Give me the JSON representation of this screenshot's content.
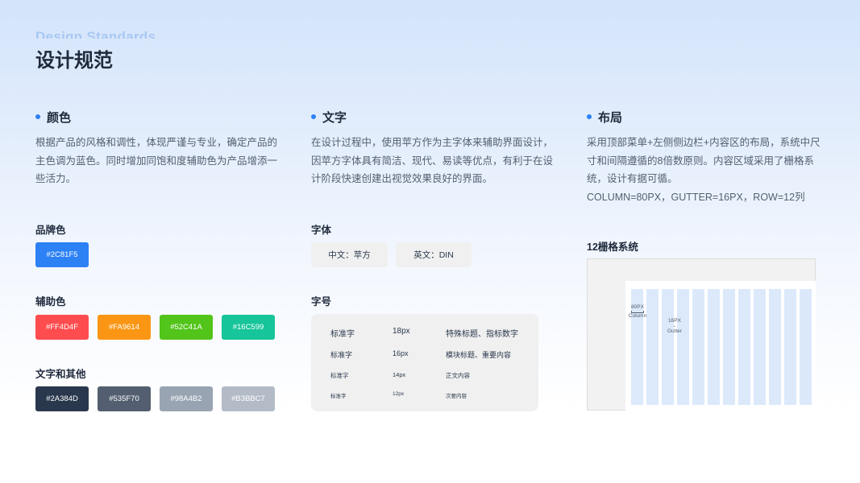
{
  "header": {
    "en_title": "Design Standards",
    "cn_title": "设计规范"
  },
  "color_section": {
    "title": "颜色",
    "desc": "根据产品的风格和调性，体现严谨与专业，确定产品的主色调为蓝色。同时增加同饱和度辅助色为产品增添一些活力。",
    "brand_label": "品牌色",
    "brand_colors": [
      "#2C81F5"
    ],
    "aux_label": "辅助色",
    "aux_colors": [
      "#FF4D4F",
      "#FA9614",
      "#52C41A",
      "#16C599"
    ],
    "text_label": "文字和其他",
    "text_colors": [
      "#2A384D",
      "#535F70",
      "#98A4B2",
      "#B3BBC7"
    ]
  },
  "text_section": {
    "title": "文字",
    "desc": "在设计过程中，使用苹方作为主字体来辅助界面设计，因苹方字体具有简洁、现代、易读等优点，有利于在设计阶段快速创建出视觉效果良好的界面。",
    "font_label": "字体",
    "font_cn": "中文：苹方",
    "font_en": "英文：DIN",
    "size_label": "字号",
    "sizes": [
      {
        "name": "标准字",
        "size": "18px",
        "usage": "特殊标题、指标数字"
      },
      {
        "name": "标准字",
        "size": "16px",
        "usage": "模块标题、重要内容"
      },
      {
        "name": "标准字",
        "size": "14px",
        "usage": "正文内容"
      },
      {
        "name": "标准字",
        "size": "12px",
        "usage": "次要内容"
      }
    ]
  },
  "layout_section": {
    "title": "布局",
    "desc": "采用顶部菜单+左侧侧边栏+内容区的布局，系统中尺寸和间隔遵循的8倍数原则。内容区域采用了栅格系统，设计有据可循。",
    "spec": "COLUMN=80PX，GUTTER=16PX，ROW=12列",
    "grid_label": "12栅格系统",
    "column_size": "80PX",
    "column_word": "Column",
    "gutter_size": "16PX",
    "gutter_word": "Gutter",
    "column_count": 12
  }
}
